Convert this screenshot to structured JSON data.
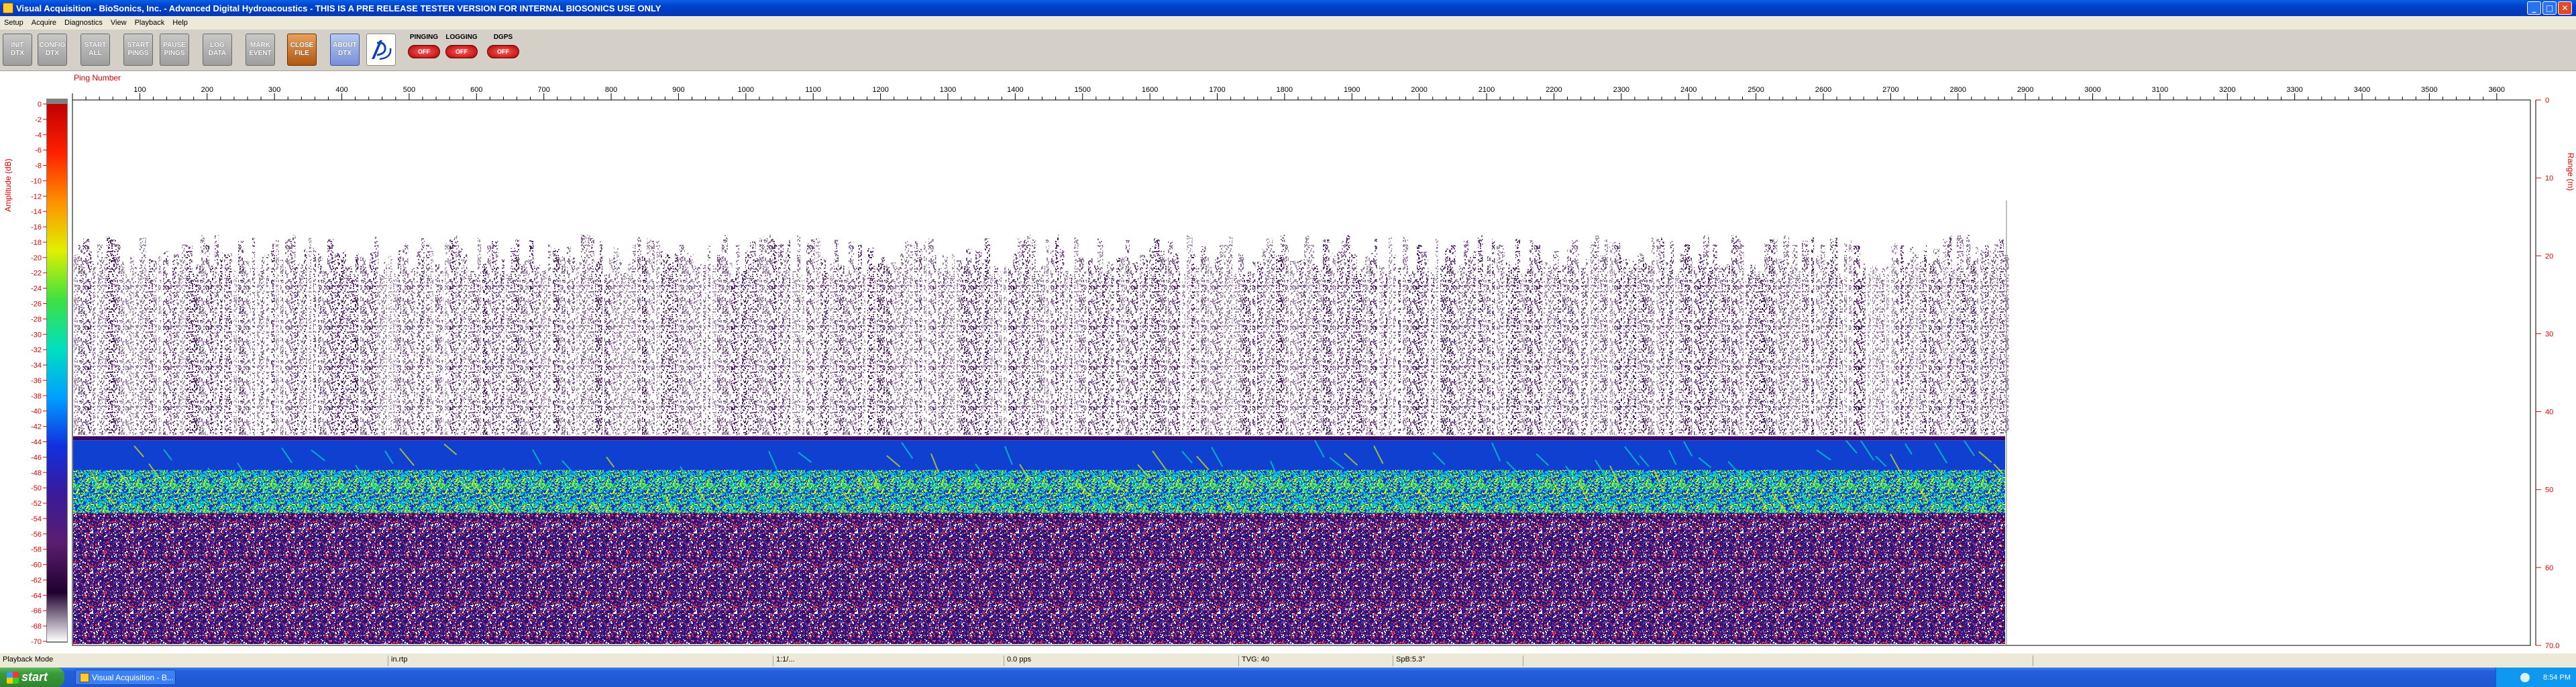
{
  "window": {
    "title": "Visual Acquisition  -  BioSonics, Inc.  -  Advanced Digital Hydroacoustics  -  THIS IS A PRE RELEASE TESTER VERSION FOR INTERNAL BIOSONICS USE ONLY",
    "min_glyph": "_",
    "max_glyph": "□",
    "close_glyph": "✕"
  },
  "menu": [
    "Setup",
    "Acquire",
    "Diagnostics",
    "View",
    "Playback",
    "Help"
  ],
  "toolbar": {
    "buttons": [
      {
        "line1": "INIT",
        "line2": "DTX",
        "style": "gray"
      },
      {
        "line1": "CONFIG",
        "line2": "DTX",
        "style": "gray"
      },
      {
        "line1": "START",
        "line2": "ALL",
        "style": "gray"
      },
      {
        "line1": "START",
        "line2": "PINGS",
        "style": "gray"
      },
      {
        "line1": "PAUSE",
        "line2": "PINGS",
        "style": "gray"
      },
      {
        "line1": "LOG",
        "line2": "DATA",
        "style": "gray"
      },
      {
        "line1": "MARK",
        "line2": "EVENT",
        "style": "gray"
      },
      {
        "line1": "CLOSE",
        "line2": "FILE",
        "style": "orange"
      },
      {
        "line1": "ABOUT",
        "line2": "DTX",
        "style": "blue"
      }
    ],
    "status_indicators": [
      {
        "label": "PINGING",
        "state": "OFF"
      },
      {
        "label": "LOGGING",
        "state": "OFF"
      },
      {
        "label": "DGPS",
        "state": "OFF"
      }
    ],
    "accent_colors": {
      "led_red": "#c00000",
      "button_gray": "#a8a8a8",
      "button_orange": "#c87030",
      "button_blue": "#8aa0e0"
    }
  },
  "chart_data": {
    "type": "heatmap",
    "title": "",
    "xlabel": "Ping Number",
    "y_left_label": "Amplitude (dB)",
    "y_right_label": "Range (m)",
    "x_range": [
      0,
      3650
    ],
    "x_ticks": [
      100,
      200,
      300,
      400,
      500,
      600,
      700,
      800,
      900,
      1000,
      1100,
      1200,
      1300,
      1400,
      1500,
      1600,
      1700,
      1800,
      1900,
      2000,
      2100,
      2200,
      2300,
      2400,
      2500,
      2600,
      2700,
      2800,
      2900,
      3000,
      3100,
      3200,
      3300,
      3400,
      3500,
      3600
    ],
    "range_m": [
      0,
      70.0
    ],
    "range_ticks": [
      "0",
      "10",
      "20",
      "30",
      "40",
      "50",
      "60",
      "70.0"
    ],
    "colorbar_db_ticks": [
      "0",
      "-2",
      "-4",
      "-6",
      "-8",
      "-10",
      "-12",
      "-14",
      "-16",
      "-18",
      "-20",
      "-22",
      "-24",
      "-26",
      "-28",
      "-30",
      "-32",
      "-34",
      "-36",
      "-38",
      "-40",
      "-42",
      "-44",
      "-46",
      "-48",
      "-50",
      "-52",
      "-54",
      "-56",
      "-58",
      "-60",
      "-62",
      "-64",
      "-66",
      "-68",
      "-70"
    ],
    "colorbar_range_db": [
      -70,
      0
    ],
    "data_extent_pings": 2870,
    "features": {
      "surface_noise_range_m": [
        19,
        43
      ],
      "bottom_line_range_m": 43.5,
      "strong_band_range_m": [
        48,
        53
      ],
      "subbottom_range_m": [
        53,
        70
      ]
    },
    "colors": {
      "colormap": [
        "#ffffff",
        "#5a1e6e",
        "#3a1a9a",
        "#1030e0",
        "#00a0ff",
        "#00e0c0",
        "#40e040",
        "#e0f000",
        "#ff9000",
        "#ff2000",
        "#c00000"
      ],
      "axis_red": "#e00000"
    }
  },
  "status": {
    "mode": "Playback Mode",
    "file": "in.rtp",
    "ratio": "1:1/...",
    "rate": "0.0 pps",
    "tvg": "TVG: 40",
    "spb": "SpB:5.3°"
  },
  "taskbar": {
    "start_label": "start",
    "task_label": "Visual Acquisition  -  B...",
    "clock": "8:54 PM"
  }
}
